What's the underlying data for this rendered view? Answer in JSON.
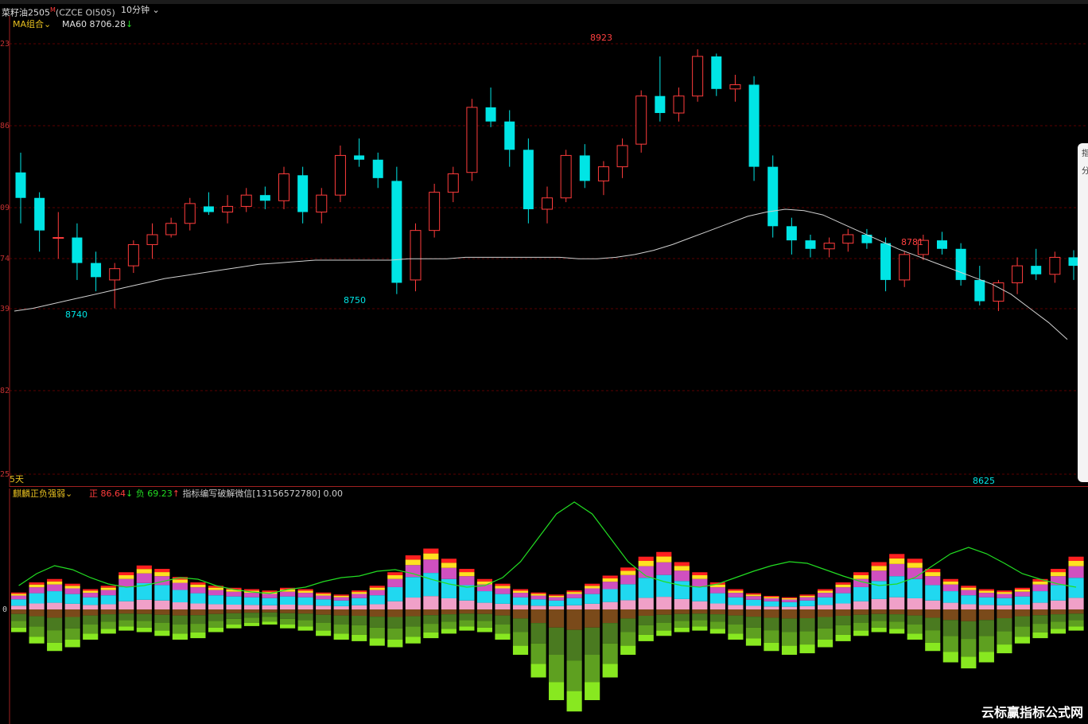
{
  "header": {
    "symbol": "菜籽油2505",
    "m_badge": "M",
    "code": "(CZCE OI505)",
    "period": "10分钟"
  },
  "main_panel": {
    "ma_group_label": "MA组合",
    "ma60_label": "MA60",
    "ma60_value": "8706.28",
    "ma60_arrow": "↓",
    "y_ticks": [
      "23",
      "86",
      "09",
      "74",
      "39",
      "82",
      "25"
    ],
    "days_label": "5天",
    "annotations": {
      "high": "8923",
      "low1": "8740",
      "low2": "8750",
      "high2": "8781",
      "low3": "8625"
    }
  },
  "sub_panel": {
    "indicator_name": "麒麟正负强弱",
    "pos_label": "正",
    "pos_value": "86.64",
    "pos_arrow": "↓",
    "neg_label": "负",
    "neg_value": "69.23",
    "neg_arrow": "↑",
    "note": "指标编写破解微信[13156572780] 0.00",
    "zero_label": "0"
  },
  "side_panel": {
    "chars": [
      "指",
      "分"
    ]
  },
  "watermark": "云标赢指标公式网",
  "colors": {
    "up": "#ff3c3c",
    "down": "#00e5e5",
    "ma60": "#d0d0d0",
    "grid": "#5a0000",
    "green_line": "#22dd22"
  },
  "chart_data": [
    {
      "type": "candlestick",
      "title": "菜籽油2505 (CZCE OI505) 10分钟",
      "series": [
        {
          "name": "MA60",
          "values": [
            8738,
            8740,
            8743,
            8746,
            8749,
            8752,
            8755,
            8758,
            8761,
            8763,
            8765,
            8767,
            8769,
            8771,
            8772,
            8773,
            8774,
            8774,
            8774,
            8774,
            8774,
            8775,
            8775,
            8775,
            8776,
            8776,
            8776,
            8776,
            8776,
            8776,
            8775,
            8775,
            8776,
            8778,
            8781,
            8785,
            8790,
            8795,
            8800,
            8805,
            8808,
            8810,
            8809,
            8806,
            8800,
            8794,
            8788,
            8782,
            8777,
            8772,
            8767,
            8762,
            8757,
            8750,
            8740,
            8730,
            8718
          ]
        }
      ],
      "ohlc": [
        [
          8836,
          8850,
          8800,
          8818
        ],
        [
          8818,
          8822,
          8780,
          8795
        ],
        [
          8790,
          8808,
          8775,
          8790
        ],
        [
          8790,
          8800,
          8760,
          8772
        ],
        [
          8772,
          8780,
          8752,
          8762
        ],
        [
          8760,
          8772,
          8740,
          8768
        ],
        [
          8770,
          8788,
          8765,
          8785
        ],
        [
          8785,
          8800,
          8775,
          8792
        ],
        [
          8792,
          8804,
          8790,
          8800
        ],
        [
          8800,
          8818,
          8795,
          8814
        ],
        [
          8812,
          8822,
          8806,
          8808
        ],
        [
          8808,
          8820,
          8800,
          8812
        ],
        [
          8812,
          8825,
          8808,
          8820
        ],
        [
          8820,
          8826,
          8810,
          8816
        ],
        [
          8816,
          8840,
          8810,
          8835
        ],
        [
          8834,
          8840,
          8800,
          8808
        ],
        [
          8808,
          8825,
          8800,
          8820
        ],
        [
          8820,
          8855,
          8815,
          8848
        ],
        [
          8848,
          8860,
          8840,
          8845
        ],
        [
          8845,
          8850,
          8825,
          8832
        ],
        [
          8830,
          8840,
          8750,
          8758
        ],
        [
          8760,
          8800,
          8752,
          8795
        ],
        [
          8795,
          8828,
          8790,
          8822
        ],
        [
          8822,
          8840,
          8815,
          8835
        ],
        [
          8836,
          8888,
          8830,
          8882
        ],
        [
          8882,
          8896,
          8868,
          8872
        ],
        [
          8872,
          8880,
          8840,
          8852
        ],
        [
          8852,
          8860,
          8800,
          8810
        ],
        [
          8810,
          8826,
          8800,
          8818
        ],
        [
          8818,
          8852,
          8815,
          8848
        ],
        [
          8848,
          8856,
          8825,
          8830
        ],
        [
          8830,
          8844,
          8820,
          8840
        ],
        [
          8840,
          8860,
          8832,
          8855
        ],
        [
          8856,
          8894,
          8850,
          8890
        ],
        [
          8890,
          8918,
          8872,
          8878
        ],
        [
          8878,
          8896,
          8872,
          8890
        ],
        [
          8890,
          8923,
          8886,
          8918
        ],
        [
          8918,
          8920,
          8890,
          8895
        ],
        [
          8895,
          8905,
          8886,
          8898
        ],
        [
          8898,
          8904,
          8830,
          8840
        ],
        [
          8840,
          8848,
          8790,
          8798
        ],
        [
          8798,
          8804,
          8778,
          8788
        ],
        [
          8788,
          8792,
          8776,
          8782
        ],
        [
          8782,
          8790,
          8776,
          8786
        ],
        [
          8786,
          8796,
          8780,
          8792
        ],
        [
          8792,
          8796,
          8782,
          8786
        ],
        [
          8786,
          8790,
          8752,
          8760
        ],
        [
          8760,
          8780,
          8755,
          8778
        ],
        [
          8778,
          8792,
          8774,
          8788
        ],
        [
          8788,
          8794,
          8778,
          8782
        ],
        [
          8782,
          8786,
          8756,
          8760
        ],
        [
          8760,
          8770,
          8742,
          8745
        ],
        [
          8745,
          8760,
          8738,
          8758
        ],
        [
          8758,
          8776,
          8750,
          8770
        ],
        [
          8770,
          8782,
          8760,
          8764
        ],
        [
          8764,
          8780,
          8758,
          8776
        ],
        [
          8776,
          8781,
          8760,
          8770
        ]
      ]
    },
    {
      "type": "bar",
      "title": "麒麟正负强弱",
      "series": [
        {
          "name": "正",
          "values": [
            25,
            40,
            45,
            38,
            30,
            35,
            55,
            65,
            60,
            48,
            40,
            35,
            32,
            30,
            28,
            32,
            30,
            25,
            22,
            28,
            35,
            55,
            80,
            90,
            75,
            60,
            45,
            38,
            30,
            25,
            22,
            28,
            38,
            50,
            62,
            78,
            85,
            70,
            55,
            40,
            30,
            24,
            20,
            18,
            22,
            30,
            40,
            55,
            70,
            82,
            75,
            60,
            45,
            35,
            30,
            28,
            32,
            45,
            60,
            78
          ]
        },
        {
          "name": "负",
          "values": [
            30,
            45,
            55,
            50,
            40,
            32,
            28,
            30,
            35,
            40,
            38,
            30,
            25,
            22,
            20,
            25,
            28,
            35,
            40,
            42,
            48,
            50,
            45,
            38,
            32,
            28,
            30,
            40,
            60,
            90,
            120,
            135,
            120,
            90,
            60,
            42,
            35,
            30,
            28,
            32,
            40,
            48,
            55,
            60,
            58,
            50,
            42,
            35,
            30,
            32,
            40,
            55,
            70,
            78,
            70,
            58,
            45,
            38,
            32,
            28
          ]
        }
      ]
    }
  ]
}
